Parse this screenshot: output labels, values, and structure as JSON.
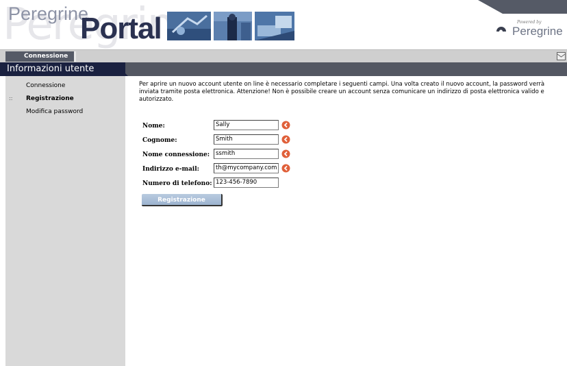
{
  "header": {
    "logo_word": "Peregrine",
    "logo_product": "Portal",
    "watermark": "Peregrine",
    "powered_by": "Powered by",
    "powered_brand": "Peregrine"
  },
  "tabs": {
    "active": "Connessione"
  },
  "section": {
    "title": "Informazioni utente"
  },
  "sidebar": {
    "items": [
      {
        "label": "Connessione",
        "active": false
      },
      {
        "label": "Registrazione",
        "active": true,
        "bullet": "::"
      },
      {
        "label": "Modifica password",
        "active": false
      }
    ]
  },
  "intro": "Per aprire un nuovo account utente on line è necessario completare i seguenti campi. Una volta creato il nuovo account, la password verrà inviata tramite posta elettronica. Attenzione! Non è possibile creare un account senza comunicare un indirizzo di posta elettronica valido e autorizzato.",
  "form": {
    "fields": [
      {
        "label": "Nome:",
        "value": "Sally",
        "required": true
      },
      {
        "label": "Cognome:",
        "value": "Smith",
        "required": true
      },
      {
        "label": "Nome connessione:",
        "value": "ssmith",
        "required": true
      },
      {
        "label": "Indirizzo e-mail:",
        "value": "th@mycompany.com",
        "required": true
      },
      {
        "label": "Numero di telefono:",
        "value": "123-456-7890",
        "required": false
      }
    ],
    "submit_label": "Registrazione"
  },
  "colors": {
    "header_dark": "#1a2140",
    "section_bar": "#535762",
    "sidebar_bg": "#d9d9d9",
    "arrow_icon": "#e0603a"
  }
}
